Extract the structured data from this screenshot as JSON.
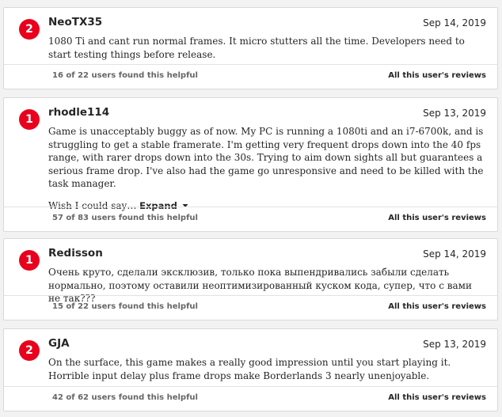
{
  "reviews": [
    {
      "score": "2",
      "user": "NeoTX35",
      "date": "Sep 14, 2019",
      "body": "1080 Ti and cant run normal frames. It micro stutters all the time. Developers need to start testing things before release.",
      "helpful": "16 of 22 users found this helpful",
      "all_reviews": "All this user's reviews"
    },
    {
      "score": "1",
      "user": "rhodle114",
      "date": "Sep 13, 2019",
      "body": "Game is unacceptably buggy as of now. My PC is running a 1080ti and an i7-6700k, and is struggling to get a stable framerate. I'm getting very frequent drops down into the 40 fps range, with rarer drops down into the 30s. Trying to aim down sights all but guarantees a serious frame drop. I've also had the game go unresponsive and need to be killed with the task manager.",
      "snippet": "Wish I could say…",
      "expand": "Expand",
      "helpful": "57 of 83 users found this helpful",
      "all_reviews": "All this user's reviews"
    },
    {
      "score": "1",
      "user": "Redisson",
      "date": "Sep 14, 2019",
      "body": "Очень круто, сделали эксклюзив, только пока выпендривались забыли сделать нормально, поэтому оставили неоптимизированный куском кода, супер, что с вами не так???",
      "helpful": "15 of 22 users found this helpful",
      "all_reviews": "All this user's reviews"
    },
    {
      "score": "2",
      "user": "GJA",
      "date": "Sep 13, 2019",
      "body": "On the surface, this game makes a really good impression until you start playing it. Horrible input delay plus frame drops make Borderlands 3 nearly unenjoyable.",
      "helpful": "42 of 62 users found this helpful",
      "all_reviews": "All this user's reviews"
    }
  ],
  "colors": {
    "score_badge": "#e9001c",
    "page_bg": "#f2f2f2"
  },
  "icons": {
    "expand": "chevron-down-icon"
  }
}
